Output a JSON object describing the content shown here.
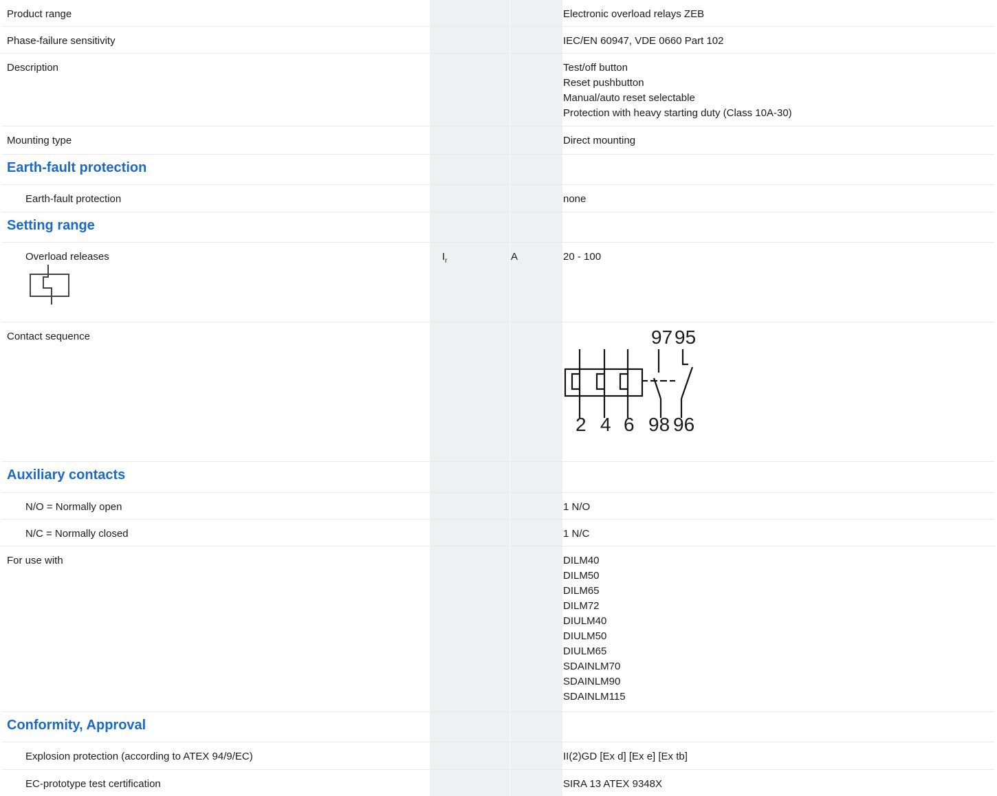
{
  "rows": {
    "product_range": {
      "label": "Product range",
      "value": "Electronic overload relays ZEB"
    },
    "phase_failure": {
      "label": "Phase-failure sensitivity",
      "value": "IEC/EN 60947, VDE 0660 Part 102"
    },
    "description": {
      "label": "Description",
      "values": [
        "Test/off button",
        "Reset pushbutton",
        "Manual/auto reset selectable",
        "Protection with heavy starting duty (Class 10A-30)"
      ]
    },
    "mounting": {
      "label": "Mounting type",
      "value": "Direct mounting"
    },
    "earth_fault_head": {
      "label": "Earth-fault protection"
    },
    "earth_fault": {
      "label": "Earth-fault protection",
      "value": "none"
    },
    "setting_head": {
      "label": "Setting range"
    },
    "overload": {
      "label": "Overload releases",
      "symbol": "I",
      "symbol_sub": "r",
      "unit": "A",
      "value": "20 - 100",
      "icon": "overload-relay-symbol-icon"
    },
    "contact_sequence": {
      "label": "Contact sequence",
      "diagram": {
        "top_labels": [
          "97",
          "95"
        ],
        "bottom_labels": [
          "2",
          "4",
          "6",
          "98",
          "96"
        ]
      }
    },
    "aux_head": {
      "label": "Auxiliary contacts"
    },
    "no": {
      "label": "N/O = Normally open",
      "value": "1 N/O"
    },
    "nc": {
      "label": "N/C = Normally closed",
      "value": "1 N/C"
    },
    "use_with": {
      "label": "For use with",
      "values": [
        "DILM40",
        "DILM50",
        "DILM65",
        "DILM72",
        "DIULM40",
        "DIULM50",
        "DIULM65",
        "SDAINLM70",
        "SDAINLM90",
        "SDAINLM115"
      ]
    },
    "conformity_head": {
      "label": "Conformity, Approval"
    },
    "explosion": {
      "label": "Explosion protection (according to ATEX 94/9/EC)",
      "value": "II(2)GD [Ex d] [Ex e] [Ex tb]"
    },
    "ec_cert": {
      "label": "EC-prototype test certification",
      "value": "SIRA 13 ATEX 9348X"
    }
  },
  "colors": {
    "heading": "#1b69c6",
    "shaded_column": "#eef0f2",
    "row_divider": "#e9e9e9"
  }
}
